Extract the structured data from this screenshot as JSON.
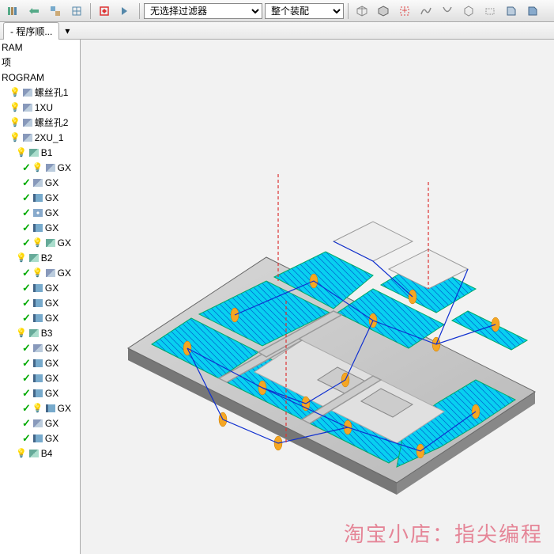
{
  "toolbar": {
    "filter_select": "无选择过滤器",
    "assembly_select": "整个装配"
  },
  "tab": {
    "title": "- 程序顺..."
  },
  "tree": {
    "nodes": [
      {
        "level": 0,
        "check": false,
        "bulb": false,
        "icon": "",
        "label": "RAM"
      },
      {
        "level": 0,
        "check": false,
        "bulb": false,
        "icon": "",
        "label": "项"
      },
      {
        "level": 0,
        "check": false,
        "bulb": false,
        "icon": "",
        "label": "ROGRAM"
      },
      {
        "level": 1,
        "check": false,
        "bulb": true,
        "icon": "op-step",
        "label": "螺丝孔1"
      },
      {
        "level": 1,
        "check": false,
        "bulb": true,
        "icon": "op-step",
        "label": "1XU"
      },
      {
        "level": 1,
        "check": false,
        "bulb": true,
        "icon": "op-step",
        "label": "螺丝孔2"
      },
      {
        "level": 1,
        "check": false,
        "bulb": true,
        "icon": "op-step",
        "label": "2XU_1"
      },
      {
        "level": 2,
        "check": false,
        "bulb": true,
        "icon": "op-step2",
        "label": "B1"
      },
      {
        "level": 3,
        "check": true,
        "bulb": true,
        "icon": "op-step",
        "label": "GX"
      },
      {
        "level": 3,
        "check": true,
        "bulb": false,
        "icon": "op-step",
        "label": "GX"
      },
      {
        "level": 3,
        "check": true,
        "bulb": false,
        "icon": "op-mill",
        "label": "GX"
      },
      {
        "level": 3,
        "check": true,
        "bulb": false,
        "icon": "op-spiral",
        "label": "GX"
      },
      {
        "level": 3,
        "check": true,
        "bulb": false,
        "icon": "op-mill",
        "label": "GX"
      },
      {
        "level": 3,
        "check": true,
        "bulb": true,
        "icon": "op-step2",
        "label": "GX"
      },
      {
        "level": 2,
        "check": false,
        "bulb": true,
        "icon": "op-step2",
        "label": "B2"
      },
      {
        "level": 3,
        "check": true,
        "bulb": true,
        "icon": "op-step",
        "label": "GX"
      },
      {
        "level": 3,
        "check": true,
        "bulb": false,
        "icon": "op-mill",
        "label": "GX"
      },
      {
        "level": 3,
        "check": true,
        "bulb": false,
        "icon": "op-mill",
        "label": "GX"
      },
      {
        "level": 3,
        "check": true,
        "bulb": false,
        "icon": "op-mill",
        "label": "GX"
      },
      {
        "level": 2,
        "check": false,
        "bulb": true,
        "icon": "op-step2",
        "label": "B3"
      },
      {
        "level": 3,
        "check": true,
        "bulb": false,
        "icon": "op-step",
        "label": "GX"
      },
      {
        "level": 3,
        "check": true,
        "bulb": false,
        "icon": "op-mill",
        "label": "GX"
      },
      {
        "level": 3,
        "check": true,
        "bulb": false,
        "icon": "op-mill",
        "label": "GX"
      },
      {
        "level": 3,
        "check": true,
        "bulb": false,
        "icon": "op-mill",
        "label": "GX"
      },
      {
        "level": 3,
        "check": true,
        "bulb": true,
        "icon": "op-mill",
        "label": "GX"
      },
      {
        "level": 3,
        "check": true,
        "bulb": false,
        "icon": "op-step",
        "label": "GX"
      },
      {
        "level": 3,
        "check": true,
        "bulb": false,
        "icon": "op-mill",
        "label": "GX"
      },
      {
        "level": 2,
        "check": false,
        "bulb": true,
        "icon": "op-step2",
        "label": "B4"
      }
    ]
  },
  "watermark": "淘宝小店：指尖编程"
}
